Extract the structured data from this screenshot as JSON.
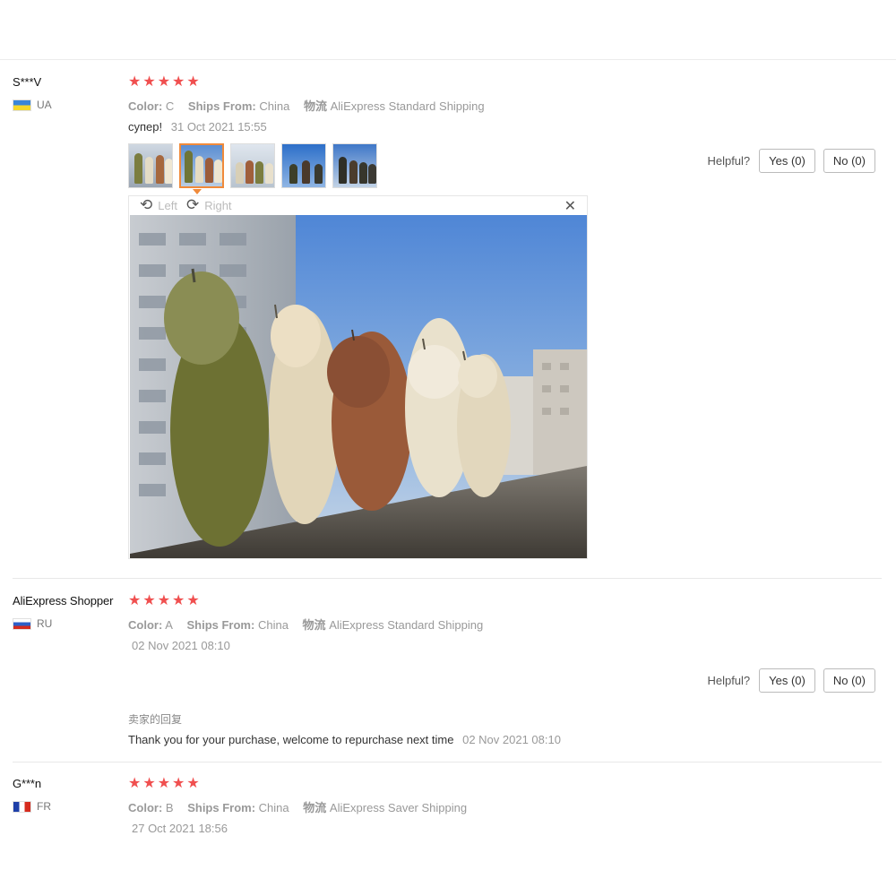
{
  "reviews": [
    {
      "user": "S***V",
      "country": "UA",
      "stars": 5,
      "color_label": "Color:",
      "color_value": "C",
      "ships_label": "Ships From:",
      "ships_value": "China",
      "logistics_label": "物流",
      "logistics_value": "AliExpress Standard Shipping",
      "text": "супер!",
      "date": "31 Oct 2021 15:55",
      "images": [
        "review-photo-1",
        "review-photo-2",
        "review-photo-3",
        "review-photo-4",
        "review-photo-5"
      ],
      "viewer": {
        "rotate_left": "Left",
        "rotate_right": "Right"
      },
      "helpful": {
        "label": "Helpful?",
        "yes": "Yes (0)",
        "no": "No (0)"
      }
    },
    {
      "user": "AliExpress Shopper",
      "country": "RU",
      "stars": 5,
      "color_label": "Color:",
      "color_value": "A",
      "ships_label": "Ships From:",
      "ships_value": "China",
      "logistics_label": "物流",
      "logistics_value": "AliExpress Standard Shipping",
      "date": "02 Nov 2021 08:10",
      "helpful": {
        "label": "Helpful?",
        "yes": "Yes (0)",
        "no": "No (0)"
      },
      "seller_reply": {
        "title": "卖家的回复",
        "text": "Thank you for your purchase, welcome to repurchase next time",
        "date": "02 Nov 2021 08:10"
      }
    },
    {
      "user": "G***n",
      "country": "FR",
      "stars": 5,
      "color_label": "Color:",
      "color_value": "B",
      "ships_label": "Ships From:",
      "ships_value": "China",
      "logistics_label": "物流",
      "logistics_value": "AliExpress Saver Shipping",
      "date": "27 Oct 2021 18:56"
    }
  ],
  "icons": {
    "star": "star-icon",
    "rotate_left": "rotate-left-icon",
    "rotate_right": "rotate-right-icon",
    "close": "close-icon"
  },
  "colors": {
    "star": "#f04f4f",
    "active_thumb_border": "#f08a3a",
    "muted_text": "#999999"
  }
}
